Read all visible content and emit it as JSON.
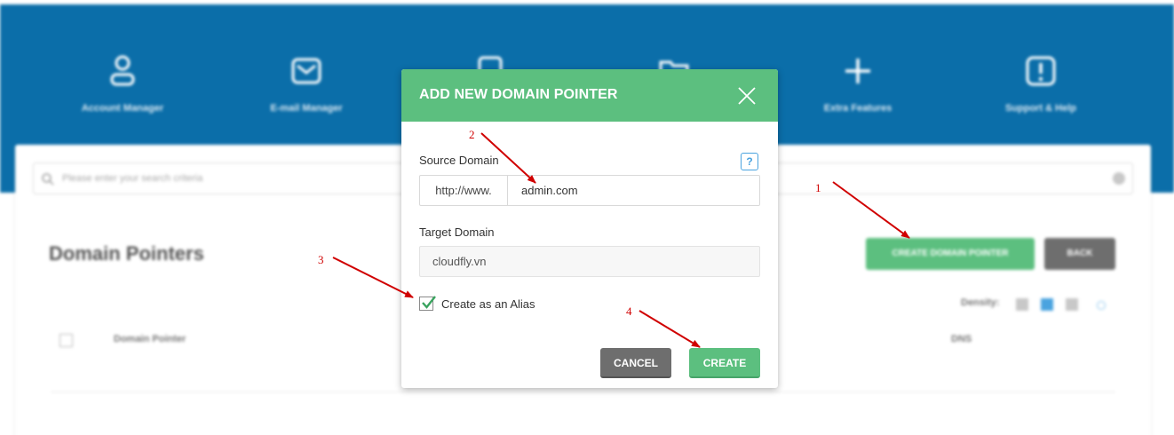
{
  "nav": {
    "items": [
      {
        "label": "Account Manager",
        "icon": "user-icon"
      },
      {
        "label": "E-mail Manager",
        "icon": "mail-icon"
      },
      {
        "label": "",
        "icon": "file-icon"
      },
      {
        "label": "",
        "icon": "folder-icon"
      },
      {
        "label": "Extra Features",
        "icon": "plus-icon"
      },
      {
        "label": "Support & Help",
        "icon": "alert-icon"
      }
    ]
  },
  "search": {
    "placeholder": "Please enter your search criteria"
  },
  "page": {
    "title": "Domain Pointers",
    "create_button": "CREATE DOMAIN POINTER",
    "back_button": "BACK",
    "density_label": "Density:",
    "table_headers": {
      "domain_pointer": "Domain Pointer",
      "dns": "DNS"
    }
  },
  "modal": {
    "title": "ADD NEW DOMAIN POINTER",
    "source_label": "Source Domain",
    "help_label": "?",
    "prefix": "http://www.",
    "source_value": "admin.com",
    "target_label": "Target Domain",
    "target_value": "cloudfly.vn",
    "alias_label": "Create as an Alias",
    "alias_checked": true,
    "cancel_label": "CANCEL",
    "create_label": "CREATE"
  },
  "annotations": [
    "1",
    "2",
    "3",
    "4"
  ],
  "colors": {
    "header_blue": "#0b6ea9",
    "accent_green": "#5cbf7f",
    "button_gray": "#6e6e6e",
    "annotation_red": "#d00000"
  }
}
